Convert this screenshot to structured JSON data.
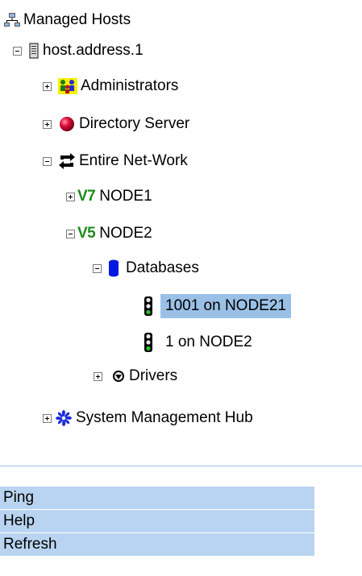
{
  "tree": {
    "root_label": "Managed Hosts",
    "host_label": "host.address.1",
    "administrators_label": "Administrators",
    "directory_server_label": "Directory Server",
    "entire_network_label": "Entire Net-Work",
    "node1": {
      "version": "V7",
      "label": "NODE1"
    },
    "node2": {
      "version": "V5",
      "label": "NODE2"
    },
    "databases_label": "Databases",
    "db1_label": "1001 on NODE21",
    "db2_label": "1 on NODE2",
    "drivers_label": "Drivers",
    "smh_label": "System Management Hub"
  },
  "actions": {
    "ping": "Ping",
    "help": "Help",
    "refresh": "Refresh"
  },
  "colors": {
    "selection": "#9ac0e6",
    "menu_button": "#b9d4f0",
    "version_green": "#1c8a1c"
  }
}
